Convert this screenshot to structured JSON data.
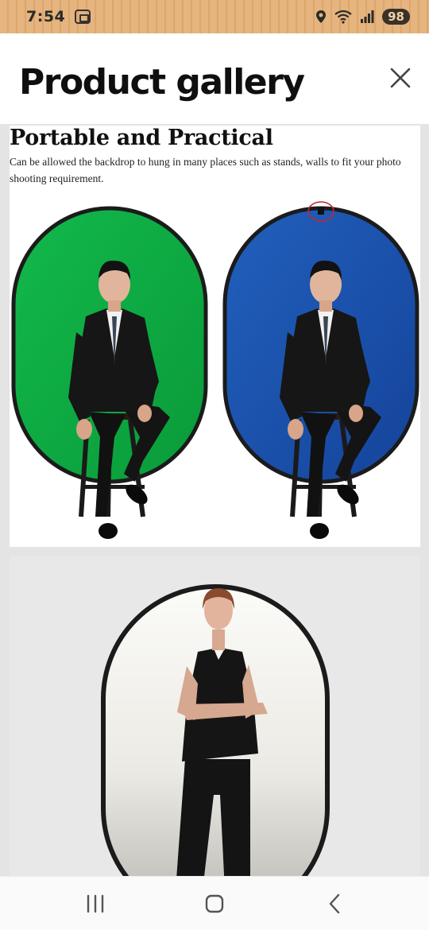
{
  "status_bar": {
    "time": "7:54",
    "battery": "98"
  },
  "header": {
    "title": "Product gallery"
  },
  "gallery": {
    "item1": {
      "heading": "Portable and Practical",
      "description": "Can be allowed the backdrop to hung in many places such as stands, walls to fit your photo shooting requirement."
    }
  },
  "colors": {
    "green_screen": "#0fae45",
    "blue_screen": "#1a4ea8",
    "white_screen": "#e8e8e8",
    "frame": "#1b1b1b"
  },
  "icons": [
    "screenshot-icon",
    "location-icon",
    "wifi-icon",
    "signal-icon",
    "close-icon",
    "recent-apps-icon",
    "home-icon",
    "back-icon"
  ]
}
